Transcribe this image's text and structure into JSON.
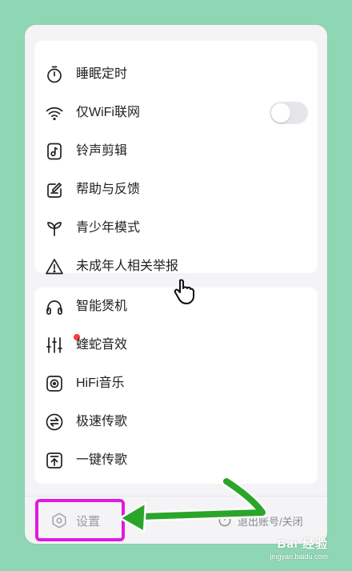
{
  "menu_group_1": [
    {
      "label": "睡眠定时",
      "icon": "timer-icon"
    },
    {
      "label": "仅WiFi联网",
      "icon": "wifi-icon",
      "toggle": {
        "on": false
      }
    },
    {
      "label": "铃声剪辑",
      "icon": "ringtone-icon"
    },
    {
      "label": "帮助与反馈",
      "icon": "feedback-icon"
    },
    {
      "label": "青少年模式",
      "icon": "sprout-icon"
    },
    {
      "label": "未成年人相关举报",
      "icon": "warning-icon"
    }
  ],
  "menu_group_2": [
    {
      "label": "智能煲机",
      "icon": "headphones-icon"
    },
    {
      "label": "蝰蛇音效",
      "icon": "equalizer-icon",
      "badge_color": "#ff3a3a"
    },
    {
      "label": "HiFi音乐",
      "icon": "hifi-icon"
    },
    {
      "label": "极速传歌",
      "icon": "transfer-icon"
    },
    {
      "label": "一键传歌",
      "icon": "upload-icon"
    }
  ],
  "bottom": {
    "settings_label": "设置",
    "logout_label": "退出账号/关闭"
  },
  "watermark": {
    "text": "Bai 经验",
    "url": "jingyan.baidu.com"
  },
  "colors": {
    "background": "#8fd6b4",
    "highlight": "#e01adf",
    "arrow": "#2aa52a"
  }
}
